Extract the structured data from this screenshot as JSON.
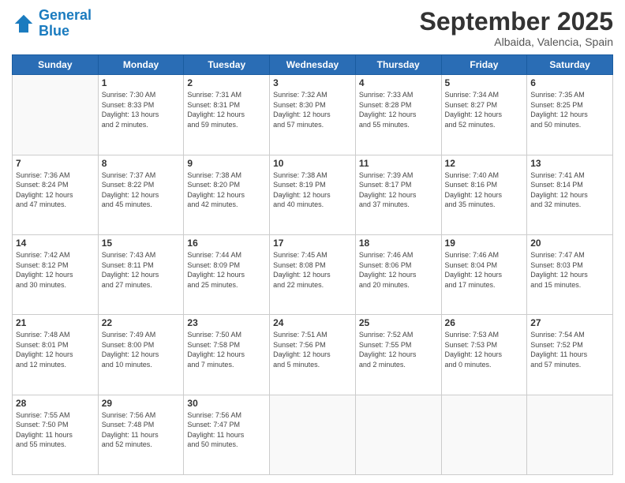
{
  "header": {
    "logo_line1": "General",
    "logo_line2": "Blue",
    "month": "September 2025",
    "location": "Albaida, Valencia, Spain"
  },
  "weekdays": [
    "Sunday",
    "Monday",
    "Tuesday",
    "Wednesday",
    "Thursday",
    "Friday",
    "Saturday"
  ],
  "weeks": [
    [
      {
        "day": "",
        "info": ""
      },
      {
        "day": "1",
        "info": "Sunrise: 7:30 AM\nSunset: 8:33 PM\nDaylight: 13 hours\nand 2 minutes."
      },
      {
        "day": "2",
        "info": "Sunrise: 7:31 AM\nSunset: 8:31 PM\nDaylight: 12 hours\nand 59 minutes."
      },
      {
        "day": "3",
        "info": "Sunrise: 7:32 AM\nSunset: 8:30 PM\nDaylight: 12 hours\nand 57 minutes."
      },
      {
        "day": "4",
        "info": "Sunrise: 7:33 AM\nSunset: 8:28 PM\nDaylight: 12 hours\nand 55 minutes."
      },
      {
        "day": "5",
        "info": "Sunrise: 7:34 AM\nSunset: 8:27 PM\nDaylight: 12 hours\nand 52 minutes."
      },
      {
        "day": "6",
        "info": "Sunrise: 7:35 AM\nSunset: 8:25 PM\nDaylight: 12 hours\nand 50 minutes."
      }
    ],
    [
      {
        "day": "7",
        "info": "Sunrise: 7:36 AM\nSunset: 8:24 PM\nDaylight: 12 hours\nand 47 minutes."
      },
      {
        "day": "8",
        "info": "Sunrise: 7:37 AM\nSunset: 8:22 PM\nDaylight: 12 hours\nand 45 minutes."
      },
      {
        "day": "9",
        "info": "Sunrise: 7:38 AM\nSunset: 8:20 PM\nDaylight: 12 hours\nand 42 minutes."
      },
      {
        "day": "10",
        "info": "Sunrise: 7:38 AM\nSunset: 8:19 PM\nDaylight: 12 hours\nand 40 minutes."
      },
      {
        "day": "11",
        "info": "Sunrise: 7:39 AM\nSunset: 8:17 PM\nDaylight: 12 hours\nand 37 minutes."
      },
      {
        "day": "12",
        "info": "Sunrise: 7:40 AM\nSunset: 8:16 PM\nDaylight: 12 hours\nand 35 minutes."
      },
      {
        "day": "13",
        "info": "Sunrise: 7:41 AM\nSunset: 8:14 PM\nDaylight: 12 hours\nand 32 minutes."
      }
    ],
    [
      {
        "day": "14",
        "info": "Sunrise: 7:42 AM\nSunset: 8:12 PM\nDaylight: 12 hours\nand 30 minutes."
      },
      {
        "day": "15",
        "info": "Sunrise: 7:43 AM\nSunset: 8:11 PM\nDaylight: 12 hours\nand 27 minutes."
      },
      {
        "day": "16",
        "info": "Sunrise: 7:44 AM\nSunset: 8:09 PM\nDaylight: 12 hours\nand 25 minutes."
      },
      {
        "day": "17",
        "info": "Sunrise: 7:45 AM\nSunset: 8:08 PM\nDaylight: 12 hours\nand 22 minutes."
      },
      {
        "day": "18",
        "info": "Sunrise: 7:46 AM\nSunset: 8:06 PM\nDaylight: 12 hours\nand 20 minutes."
      },
      {
        "day": "19",
        "info": "Sunrise: 7:46 AM\nSunset: 8:04 PM\nDaylight: 12 hours\nand 17 minutes."
      },
      {
        "day": "20",
        "info": "Sunrise: 7:47 AM\nSunset: 8:03 PM\nDaylight: 12 hours\nand 15 minutes."
      }
    ],
    [
      {
        "day": "21",
        "info": "Sunrise: 7:48 AM\nSunset: 8:01 PM\nDaylight: 12 hours\nand 12 minutes."
      },
      {
        "day": "22",
        "info": "Sunrise: 7:49 AM\nSunset: 8:00 PM\nDaylight: 12 hours\nand 10 minutes."
      },
      {
        "day": "23",
        "info": "Sunrise: 7:50 AM\nSunset: 7:58 PM\nDaylight: 12 hours\nand 7 minutes."
      },
      {
        "day": "24",
        "info": "Sunrise: 7:51 AM\nSunset: 7:56 PM\nDaylight: 12 hours\nand 5 minutes."
      },
      {
        "day": "25",
        "info": "Sunrise: 7:52 AM\nSunset: 7:55 PM\nDaylight: 12 hours\nand 2 minutes."
      },
      {
        "day": "26",
        "info": "Sunrise: 7:53 AM\nSunset: 7:53 PM\nDaylight: 12 hours\nand 0 minutes."
      },
      {
        "day": "27",
        "info": "Sunrise: 7:54 AM\nSunset: 7:52 PM\nDaylight: 11 hours\nand 57 minutes."
      }
    ],
    [
      {
        "day": "28",
        "info": "Sunrise: 7:55 AM\nSunset: 7:50 PM\nDaylight: 11 hours\nand 55 minutes."
      },
      {
        "day": "29",
        "info": "Sunrise: 7:56 AM\nSunset: 7:48 PM\nDaylight: 11 hours\nand 52 minutes."
      },
      {
        "day": "30",
        "info": "Sunrise: 7:56 AM\nSunset: 7:47 PM\nDaylight: 11 hours\nand 50 minutes."
      },
      {
        "day": "",
        "info": ""
      },
      {
        "day": "",
        "info": ""
      },
      {
        "day": "",
        "info": ""
      },
      {
        "day": "",
        "info": ""
      }
    ]
  ]
}
